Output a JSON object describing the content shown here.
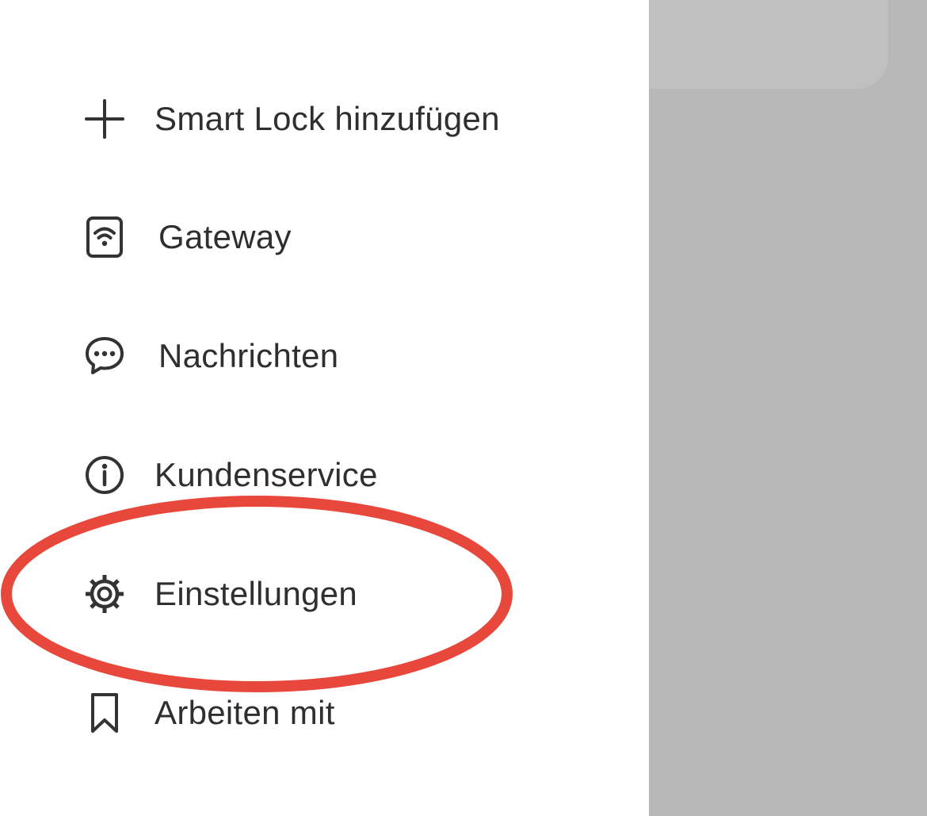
{
  "menu": {
    "items": [
      {
        "key": "add-smart-lock",
        "label": "Smart Lock hinzufügen",
        "icon": "plus-icon"
      },
      {
        "key": "gateway",
        "label": "Gateway",
        "icon": "wifi-box-icon"
      },
      {
        "key": "messages",
        "label": "Nachrichten",
        "icon": "chat-bubble-icon"
      },
      {
        "key": "customer-service",
        "label": "Kundenservice",
        "icon": "info-icon"
      },
      {
        "key": "settings",
        "label": "Einstellungen",
        "icon": "gear-icon"
      },
      {
        "key": "works-with",
        "label": "Arbeiten mit",
        "icon": "bookmark-icon"
      }
    ]
  },
  "annotation": {
    "target": "settings",
    "color": "#e8483b"
  },
  "colors": {
    "drawer_bg": "#ffffff",
    "overlay": "#b8b8b8",
    "text": "#2f2f2f",
    "icon": "#333333"
  }
}
